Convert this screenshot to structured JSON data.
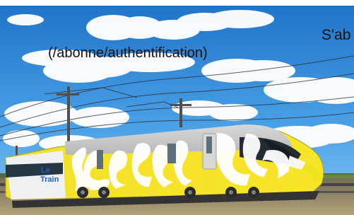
{
  "hero": {
    "alt": "Train jaune Le Train",
    "logo_line1": "Le",
    "logo_line2": "Train",
    "accent_color": "#f4e21c",
    "sky_color": "#2f8ad8"
  },
  "overlay": {
    "auth_link": "(/abonne/authentification)",
    "heading_partial": "S'ab"
  }
}
